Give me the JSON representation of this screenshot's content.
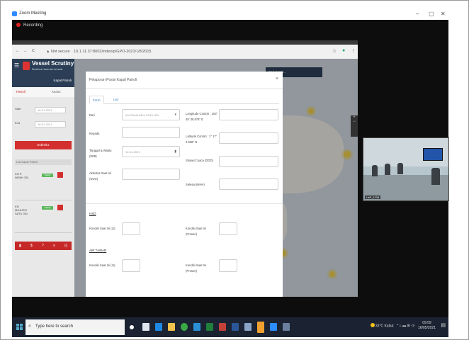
{
  "window": {
    "title": "Zoom Meeting",
    "recording_label": "Recording",
    "minimize": "–",
    "maximize": "▢",
    "close": "✕"
  },
  "browser": {
    "nav_back": "←",
    "nav_forward": "→",
    "reload": "C",
    "security": "▲ Not secure",
    "url": "10.1.11.37:8002/index/p/GPO-2021/1/8/2015"
  },
  "app": {
    "brand": "Vessel Scrutiny",
    "subtitle": "Direktorat Jasa dan Armada",
    "section": "Kapal Patroli",
    "tabs": [
      "Patroli",
      "Kasus"
    ],
    "filters": [
      {
        "label": "Start",
        "value": "16-01-2021"
      },
      {
        "label": "End",
        "value": "16-01-2021"
      }
    ],
    "submit": "Submit ▸",
    "list_header": "List Kapal Patroli",
    "items": [
      {
        "name": "KN P. NIPAH 331",
        "badge": "Patroli"
      },
      {
        "name": "KN MAJURO SATU 301",
        "badge": "Patroli"
      }
    ],
    "map_search": "Cari Kapal..."
  },
  "modal": {
    "title": "Pelaporan Posisi Kapal Patroli",
    "close": "×",
    "tabs": [
      "Form",
      "List"
    ],
    "fields_left": [
      {
        "label": "Dari",
        "value": "KN TAKALAR/1 SATU 301"
      },
      {
        "label": "Kepada",
        "value": ""
      },
      {
        "label": "Tanggal & Waktu (WIB)",
        "value": "12-01-2021"
      },
      {
        "label": "Aktivitas Saat Ini (SOG)",
        "value": ""
      }
    ],
    "fields_right": [
      {
        "label": "Longitude Contoh : 103° 45' 36.576\" E"
      },
      {
        "label": "Latitude Contoh : 1° 17' 2.538\" N"
      },
      {
        "label": "Situasi Cuaca (DDD)"
      },
      {
        "label": "Selesai (HHH)"
      }
    ],
    "section_hsd": "HSD",
    "section_air": "AIR TAWAR",
    "kondisi_ini": "Kondisi Saat Ini (Lt)",
    "kondisi_prosen": "Kondisi Saat Ini (Prosen)"
  },
  "video": {
    "name": "LaP_1234"
  },
  "taskbar": {
    "search_placeholder": "Type here to search",
    "weather": "33°C Kabut",
    "time": "09:59",
    "date": "16/05/2021"
  }
}
